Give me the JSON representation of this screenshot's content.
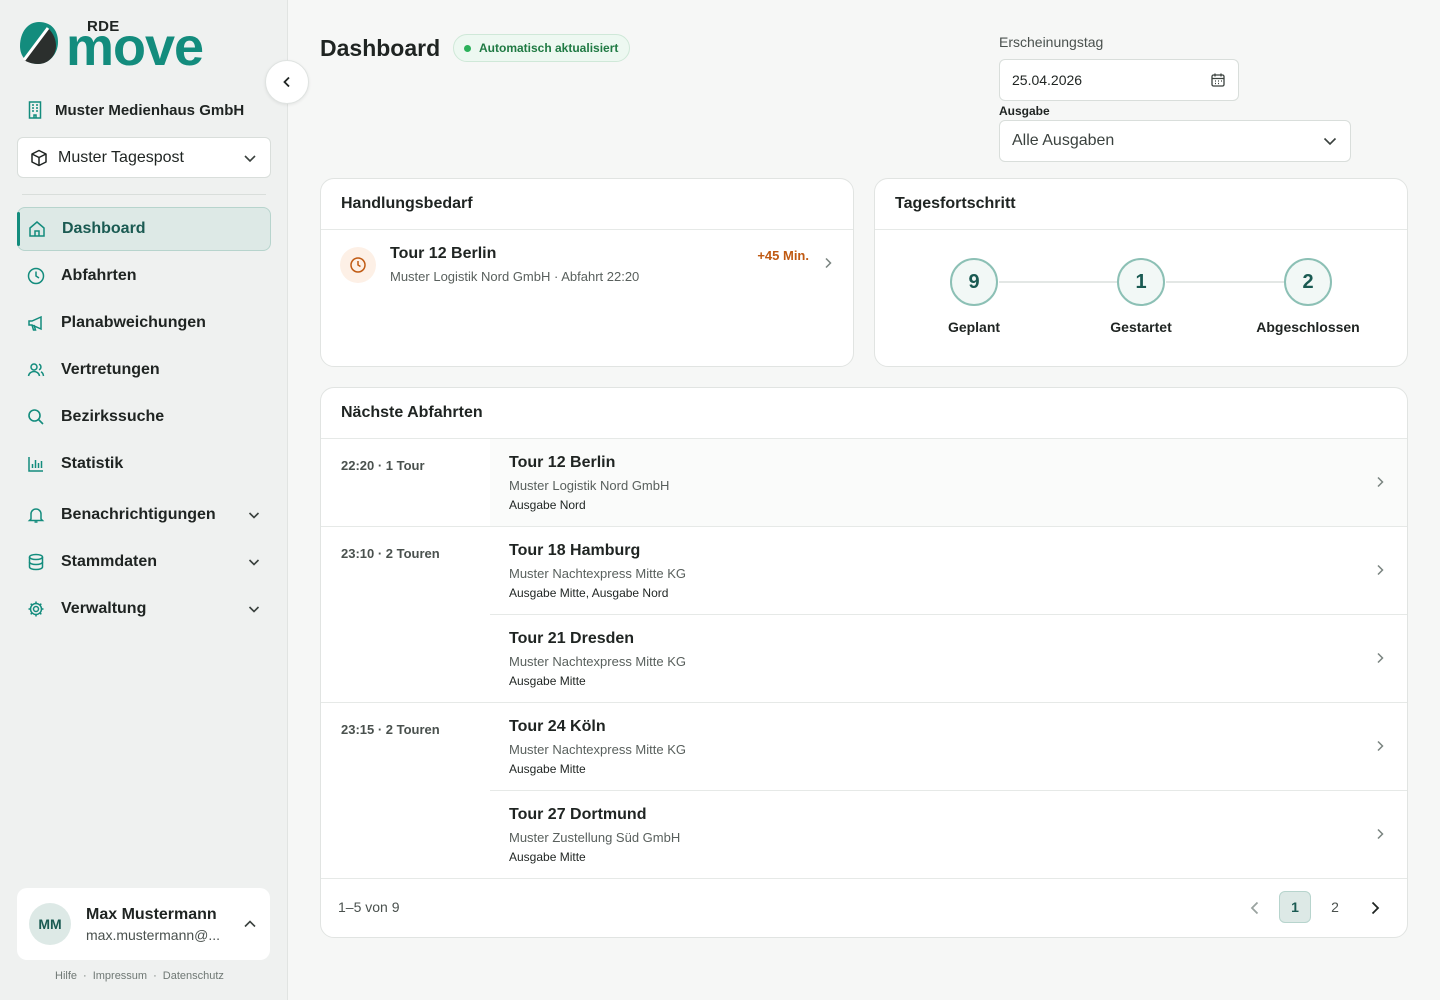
{
  "brand": {
    "prefix": "RDE",
    "name": "move"
  },
  "organization": "Muster Medienhaus GmbH",
  "publication": "Muster Tagespost",
  "nav": [
    {
      "label": "Dashboard",
      "icon": "home-icon",
      "active": true
    },
    {
      "label": "Abfahrten",
      "icon": "clock-icon"
    },
    {
      "label": "Planabweichungen",
      "icon": "megaphone-icon"
    },
    {
      "label": "Vertretungen",
      "icon": "users-icon"
    },
    {
      "label": "Bezirkssuche",
      "icon": "search-icon"
    },
    {
      "label": "Statistik",
      "icon": "bar-chart-icon"
    },
    {
      "label": "Benachrichtigungen",
      "icon": "bell-icon",
      "expandable": true
    },
    {
      "label": "Stammdaten",
      "icon": "database-icon",
      "expandable": true
    },
    {
      "label": "Verwaltung",
      "icon": "gear-icon",
      "expandable": true
    }
  ],
  "user": {
    "initials": "MM",
    "name": "Max Mustermann",
    "email": "max.mustermann@..."
  },
  "footer": {
    "help": "Hilfe",
    "imprint": "Impressum",
    "privacy": "Datenschutz",
    "separator": "·"
  },
  "header": {
    "title": "Dashboard",
    "badge": "Automatisch aktualisiert",
    "date_label": "Erscheinungstag",
    "date_value": "25.04.2026",
    "edition_label": "Ausgabe",
    "edition_value": "Alle Ausgaben"
  },
  "action_needed": {
    "title": "Handlungsbedarf",
    "item": {
      "tour": "Tour 12 Berlin",
      "detail": "Muster Logistik Nord GmbH · Abfahrt 22:20",
      "delay": "+45 Min."
    }
  },
  "progress": {
    "title": "Tagesfortschritt",
    "steps": [
      {
        "value": "9",
        "label": "Geplant"
      },
      {
        "value": "1",
        "label": "Gestartet"
      },
      {
        "value": "2",
        "label": "Abgeschlossen"
      }
    ]
  },
  "departures": {
    "title": "Nächste Abfahrten",
    "rows": [
      {
        "time": "22:20 · 1 Tour",
        "tour": "Tour 12 Berlin",
        "company": "Muster Logistik Nord GmbH",
        "editions": "Ausgabe Nord"
      },
      {
        "time": "23:10 · 2 Touren",
        "tour": "Tour 18 Hamburg",
        "company": "Muster Nachtexpress Mitte KG",
        "editions": "Ausgabe Mitte, Ausgabe Nord"
      },
      {
        "time": "",
        "tour": "Tour 21 Dresden",
        "company": "Muster Nachtexpress Mitte KG",
        "editions": "Ausgabe Mitte"
      },
      {
        "time": "23:15 · 2 Touren",
        "tour": "Tour 24 Köln",
        "company": "Muster Nachtexpress Mitte KG",
        "editions": "Ausgabe Mitte"
      },
      {
        "time": "",
        "tour": "Tour 27 Dortmund",
        "company": "Muster Zustellung Süd GmbH",
        "editions": "Ausgabe Mitte"
      }
    ],
    "pagination": {
      "summary": "1–5 von 9",
      "pages": [
        "1",
        "2"
      ],
      "current": "1"
    }
  },
  "colors": {
    "accent": "#138c7d",
    "warning": "#c05a12",
    "success": "#2bb15a"
  }
}
